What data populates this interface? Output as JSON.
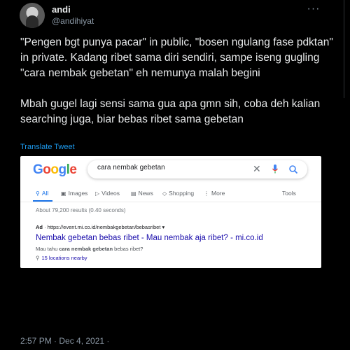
{
  "author": {
    "name": "andi",
    "handle": "@andihiyat"
  },
  "more_glyph": "···",
  "tweet_text": "\"Pengen bgt punya pacar\" in public, \"bosen ngulang fase pdktan\" in private. Kadang ribet sama diri sendiri, sampe iseng gugling \"cara nembak gebetan\" eh nemunya malah begini\n\nMbah gugel lagi sensi sama gua apa gmn sih, coba deh kalian searching juga, biar bebas ribet sama gebetan",
  "translate_label": "Translate Tweet",
  "screenshot": {
    "logo_letters": [
      "G",
      "o",
      "o",
      "g",
      "l",
      "e"
    ],
    "search_value": "cara nembak gebetan",
    "tabs": [
      {
        "label": "All",
        "icon": "search-icon"
      },
      {
        "label": "Images",
        "icon": "image-icon"
      },
      {
        "label": "Videos",
        "icon": "video-icon"
      },
      {
        "label": "News",
        "icon": "news-icon"
      },
      {
        "label": "Shopping",
        "icon": "tag-icon"
      },
      {
        "label": "More",
        "icon": "more-icon"
      },
      {
        "label": "Tools",
        "icon": ""
      }
    ],
    "tab_glyphs": {
      "all": "⚲",
      "images": "▣",
      "videos": "▷",
      "news": "▤",
      "shopping": "◇",
      "more": "⋮"
    },
    "results_stats": "About 79,200 results (0.40 seconds)",
    "ad": {
      "label": "Ad",
      "url": "https://event.mi.co.id/nembakgebetan/bebasribet",
      "title": "Nembak gebetan bebas ribet - Mau nembak aja ribet? - mi.co.id",
      "desc_pre": "Mau tahu ",
      "desc_bold": "cara nembak gebetan",
      "desc_post": " bebas ribet?",
      "location": "15 locations nearby"
    }
  },
  "timestamp": "2:57 PM · Dec 4, 2021 ·",
  "colors": {
    "background": "#000000",
    "link_blue": "#1d9bf0",
    "google_link": "#1a0dab",
    "google_accent": "#1a73e8"
  }
}
